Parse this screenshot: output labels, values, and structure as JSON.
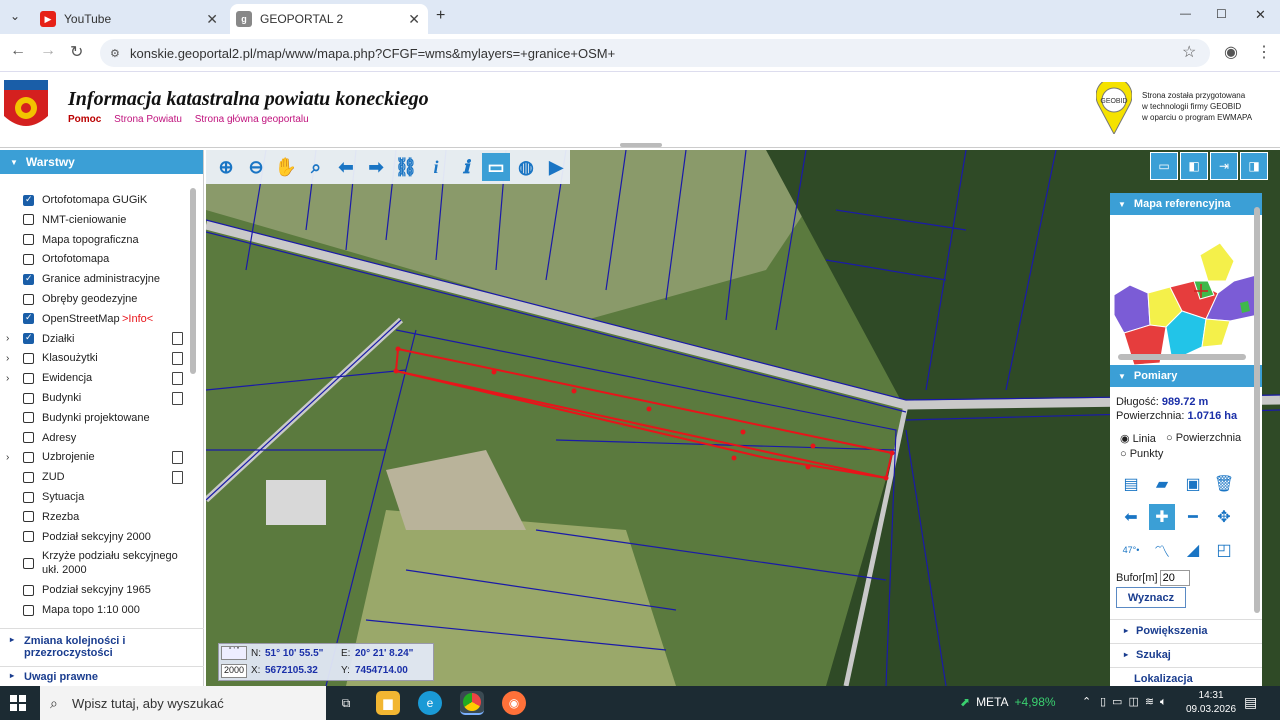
{
  "browser": {
    "tabs": [
      {
        "title": "YouTube",
        "close": "✕"
      },
      {
        "title": "GEOPORTAL 2",
        "close": "✕"
      }
    ],
    "new_tab": "+",
    "url": "konskie.geoportal2.pl/map/www/mapa.php?CFGF=wms&mylayers=+granice+OSM+",
    "window_controls": {
      "minimize": "—",
      "maximize": "☐",
      "close": "✕"
    }
  },
  "header": {
    "title": "Informacja katastralna powiatu koneckiego",
    "links": [
      "Pomoc",
      "Strona Powiatu",
      "Strona główna geoportalu"
    ],
    "credit": [
      "Strona została przygotowana",
      "w technologii firmy GEOBID",
      "w oparciu o program EWMAPA"
    ],
    "geobid_label": "GEOBID"
  },
  "layers_panel": {
    "title": "Warstwy",
    "items": [
      {
        "label": "Ortofotomapa GUGiK",
        "checked": true
      },
      {
        "label": "NMT-cieniowanie",
        "checked": false
      },
      {
        "label": "Mapa topograficzna",
        "checked": false
      },
      {
        "label": "Ortofotomapa",
        "checked": false
      },
      {
        "label": "Granice administracyjne",
        "checked": true
      },
      {
        "label": "Obręby geodezyjne",
        "checked": false
      },
      {
        "label": "OpenStreetMap",
        "checked": true,
        "extra": ">Info<"
      },
      {
        "label": "Działki",
        "checked": true,
        "expand": true,
        "doc": true
      },
      {
        "label": "Klasoużytki",
        "checked": false,
        "expand": true,
        "doc": true
      },
      {
        "label": "Ewidencja",
        "checked": false,
        "expand": true,
        "doc": true
      },
      {
        "label": "Budynki",
        "checked": false,
        "doc": true
      },
      {
        "label": "Budynki projektowane",
        "checked": false
      },
      {
        "label": "Adresy",
        "checked": false
      },
      {
        "label": "Uzbrojenie",
        "checked": false,
        "expand": true,
        "doc": true
      },
      {
        "label": "ZUD",
        "checked": false,
        "doc": true
      },
      {
        "label": "Sytuacja",
        "checked": false
      },
      {
        "label": "Rzezba",
        "checked": false
      },
      {
        "label": "Podział sekcyjny 2000",
        "checked": false
      },
      {
        "label": "Krzyże podziału sekcyjnego ukł. 2000",
        "checked": false
      },
      {
        "label": "Podział sekcyjny 1965",
        "checked": false
      },
      {
        "label": "Mapa topo 1:10 000",
        "checked": false
      }
    ],
    "footer_order": "Zmiana kolejności i przezroczystości",
    "footer_legal": "Uwagi prawne"
  },
  "coords": {
    "n_label": "N:",
    "n_value": "51° 10' 55.5\"",
    "e_label": "E:",
    "e_value": "20° 21' 8.24\"",
    "x_label": "X:",
    "x_value": "5672105.32",
    "y_label": "Y:",
    "y_value": "7454714.00",
    "system": "2000"
  },
  "right_panel": {
    "reference_title": "Mapa referencyjna",
    "measure_title": "Pomiary",
    "length_label": "Długość:",
    "length_value": "989.72 m",
    "area_label": "Powierzchnia:",
    "area_value": "1.0716 ha",
    "mode_line": "Linia",
    "mode_area": "Powierzchnia",
    "mode_points": "Punkty",
    "buffer_label": "Bufor[m]",
    "buffer_value": "20",
    "compute_button": "Wyznacz",
    "sections": [
      "Powiększenia",
      "Szukaj",
      "Lokalizacja"
    ]
  },
  "taskbar": {
    "search_placeholder": "Wpisz tutaj, aby wyszukać",
    "stock_name": "META",
    "stock_change": "+4,98%",
    "time": "14:31",
    "date": "09.03.2026"
  },
  "colors": {
    "accent": "#3b9fd6",
    "link": "#c0127d",
    "measure": "#e8141a",
    "stock_up": "#3ad06f"
  }
}
